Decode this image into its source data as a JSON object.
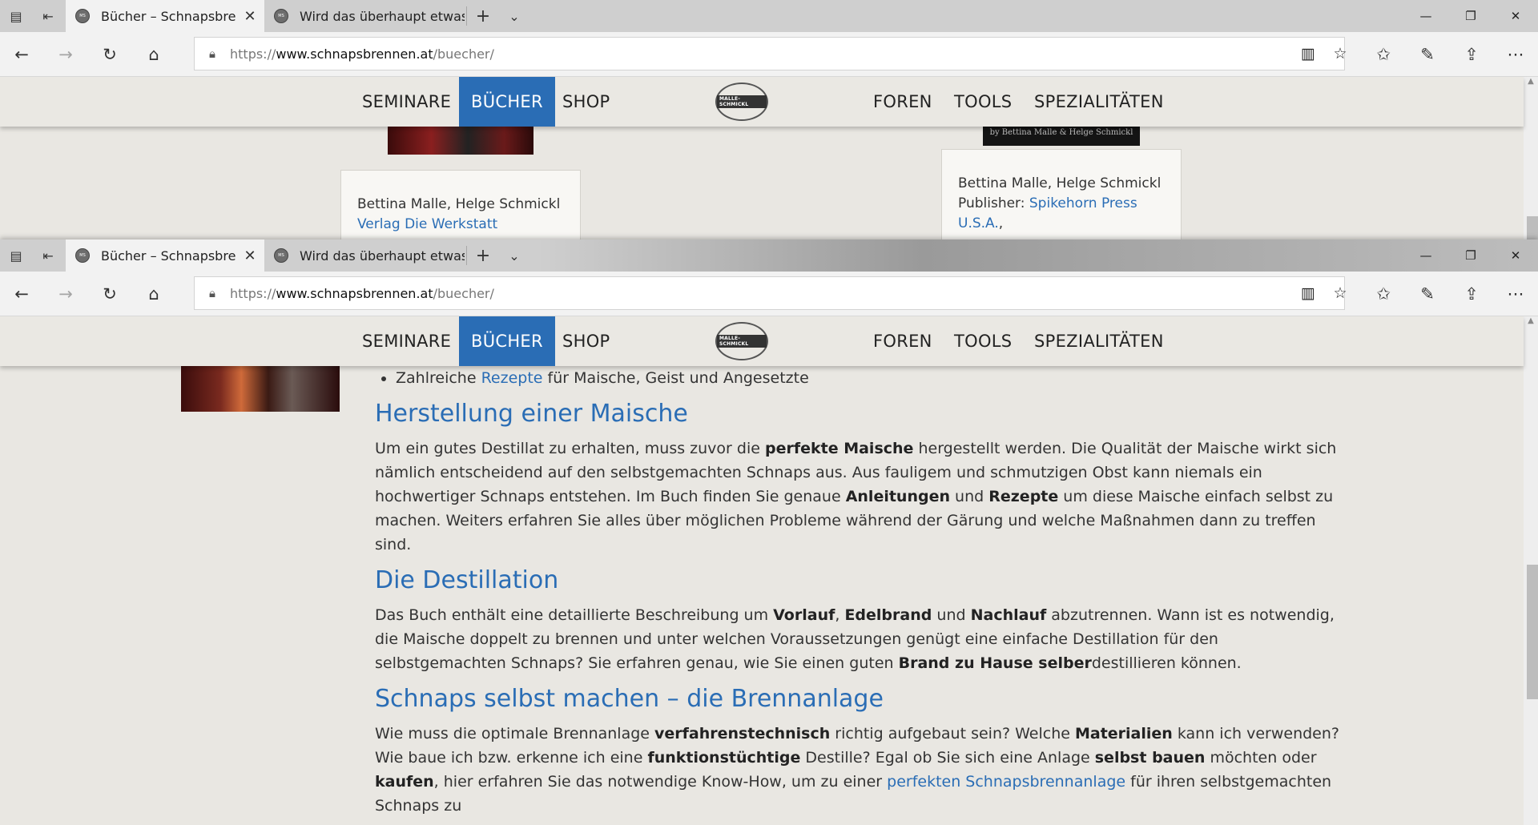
{
  "browser": {
    "tabs": [
      {
        "title": "Bücher – Schnapsbrenn",
        "active": true
      },
      {
        "title": "Wird das überhaupt etwas?",
        "active": false
      }
    ],
    "url": {
      "scheme": "https://",
      "host": "www.schnapsbrennen.at",
      "path": "/buecher/"
    }
  },
  "site_nav": {
    "left": [
      "SEMINARE",
      "BÜCHER",
      "SHOP"
    ],
    "right": [
      "FOREN",
      "TOOLS",
      "SPEZIALITÄTEN"
    ],
    "active": "BÜCHER",
    "logo_text": "MALLE-SCHMICKL"
  },
  "window1": {
    "book2_cover_text": "by Bettina Malle & Helge Schmickl",
    "card1": {
      "authors": "Bettina Malle, Helge Schmickl",
      "publisher_link": "Verlag Die Werkstatt"
    },
    "card2": {
      "authors": "Bettina Malle, Helge Schmickl",
      "publisher_label": "Publisher: ",
      "publisher_link": "Spikehorn Press U.S.A.",
      "publisher_suffix": ","
    }
  },
  "article": {
    "bullet": {
      "pre": "Zahlreiche ",
      "link": "Rezepte",
      "post": " für Maische, Geist und Angesetzte"
    },
    "sections": [
      {
        "heading": "Herstellung einer Maische",
        "p": [
          "Um ein gutes Destillat zu erhalten, muss zuvor die ",
          "perfekte Maische",
          " hergestellt werden. Die Qualität der Maische wirkt sich nämlich entscheidend auf den selbstgemachten Schnaps aus. Aus fauligem und schmutzigen Obst kann niemals ein hochwertiger Schnaps entstehen. Im Buch finden Sie genaue ",
          "Anleitungen",
          " und ",
          "Rezepte",
          " um diese Maische einfach selbst zu machen. Weiters erfahren Sie alles über möglichen Probleme während der Gärung und welche Maßnahmen dann zu treffen sind."
        ]
      },
      {
        "heading": "Die Destillation",
        "p": [
          "Das Buch enthält eine detaillierte Beschreibung um ",
          "Vorlauf",
          ", ",
          "Edelbrand",
          " und ",
          "Nachlauf",
          " abzutrennen. Wann ist es notwendig, die Maische doppelt zu brennen und unter welchen Voraussetzungen genügt eine einfache Destillation für den selbstgemachten Schnaps? Sie erfahren genau, wie Sie einen guten ",
          "Brand zu Hause selber",
          "destillieren können."
        ]
      },
      {
        "heading": "Schnaps selbst machen – die Brennanlage",
        "p": [
          "Wie muss die optimale Brennanlage ",
          "verfahrenstechnisch",
          " richtig aufgebaut sein? Welche ",
          "Materialien",
          " kann ich verwenden? Wie baue ich bzw. erkenne ich eine ",
          "funktionstüchtige",
          " Destille? Egal ob Sie sich eine Anlage ",
          "selbst bauen",
          " möchten oder ",
          "kaufen",
          ", hier erfahren Sie das notwendige Know-How, um zu einer "
        ],
        "link": "perfekten Schnapsbrennanlage",
        "tail": " für ihren selbstgemachten Schnaps zu"
      }
    ]
  }
}
